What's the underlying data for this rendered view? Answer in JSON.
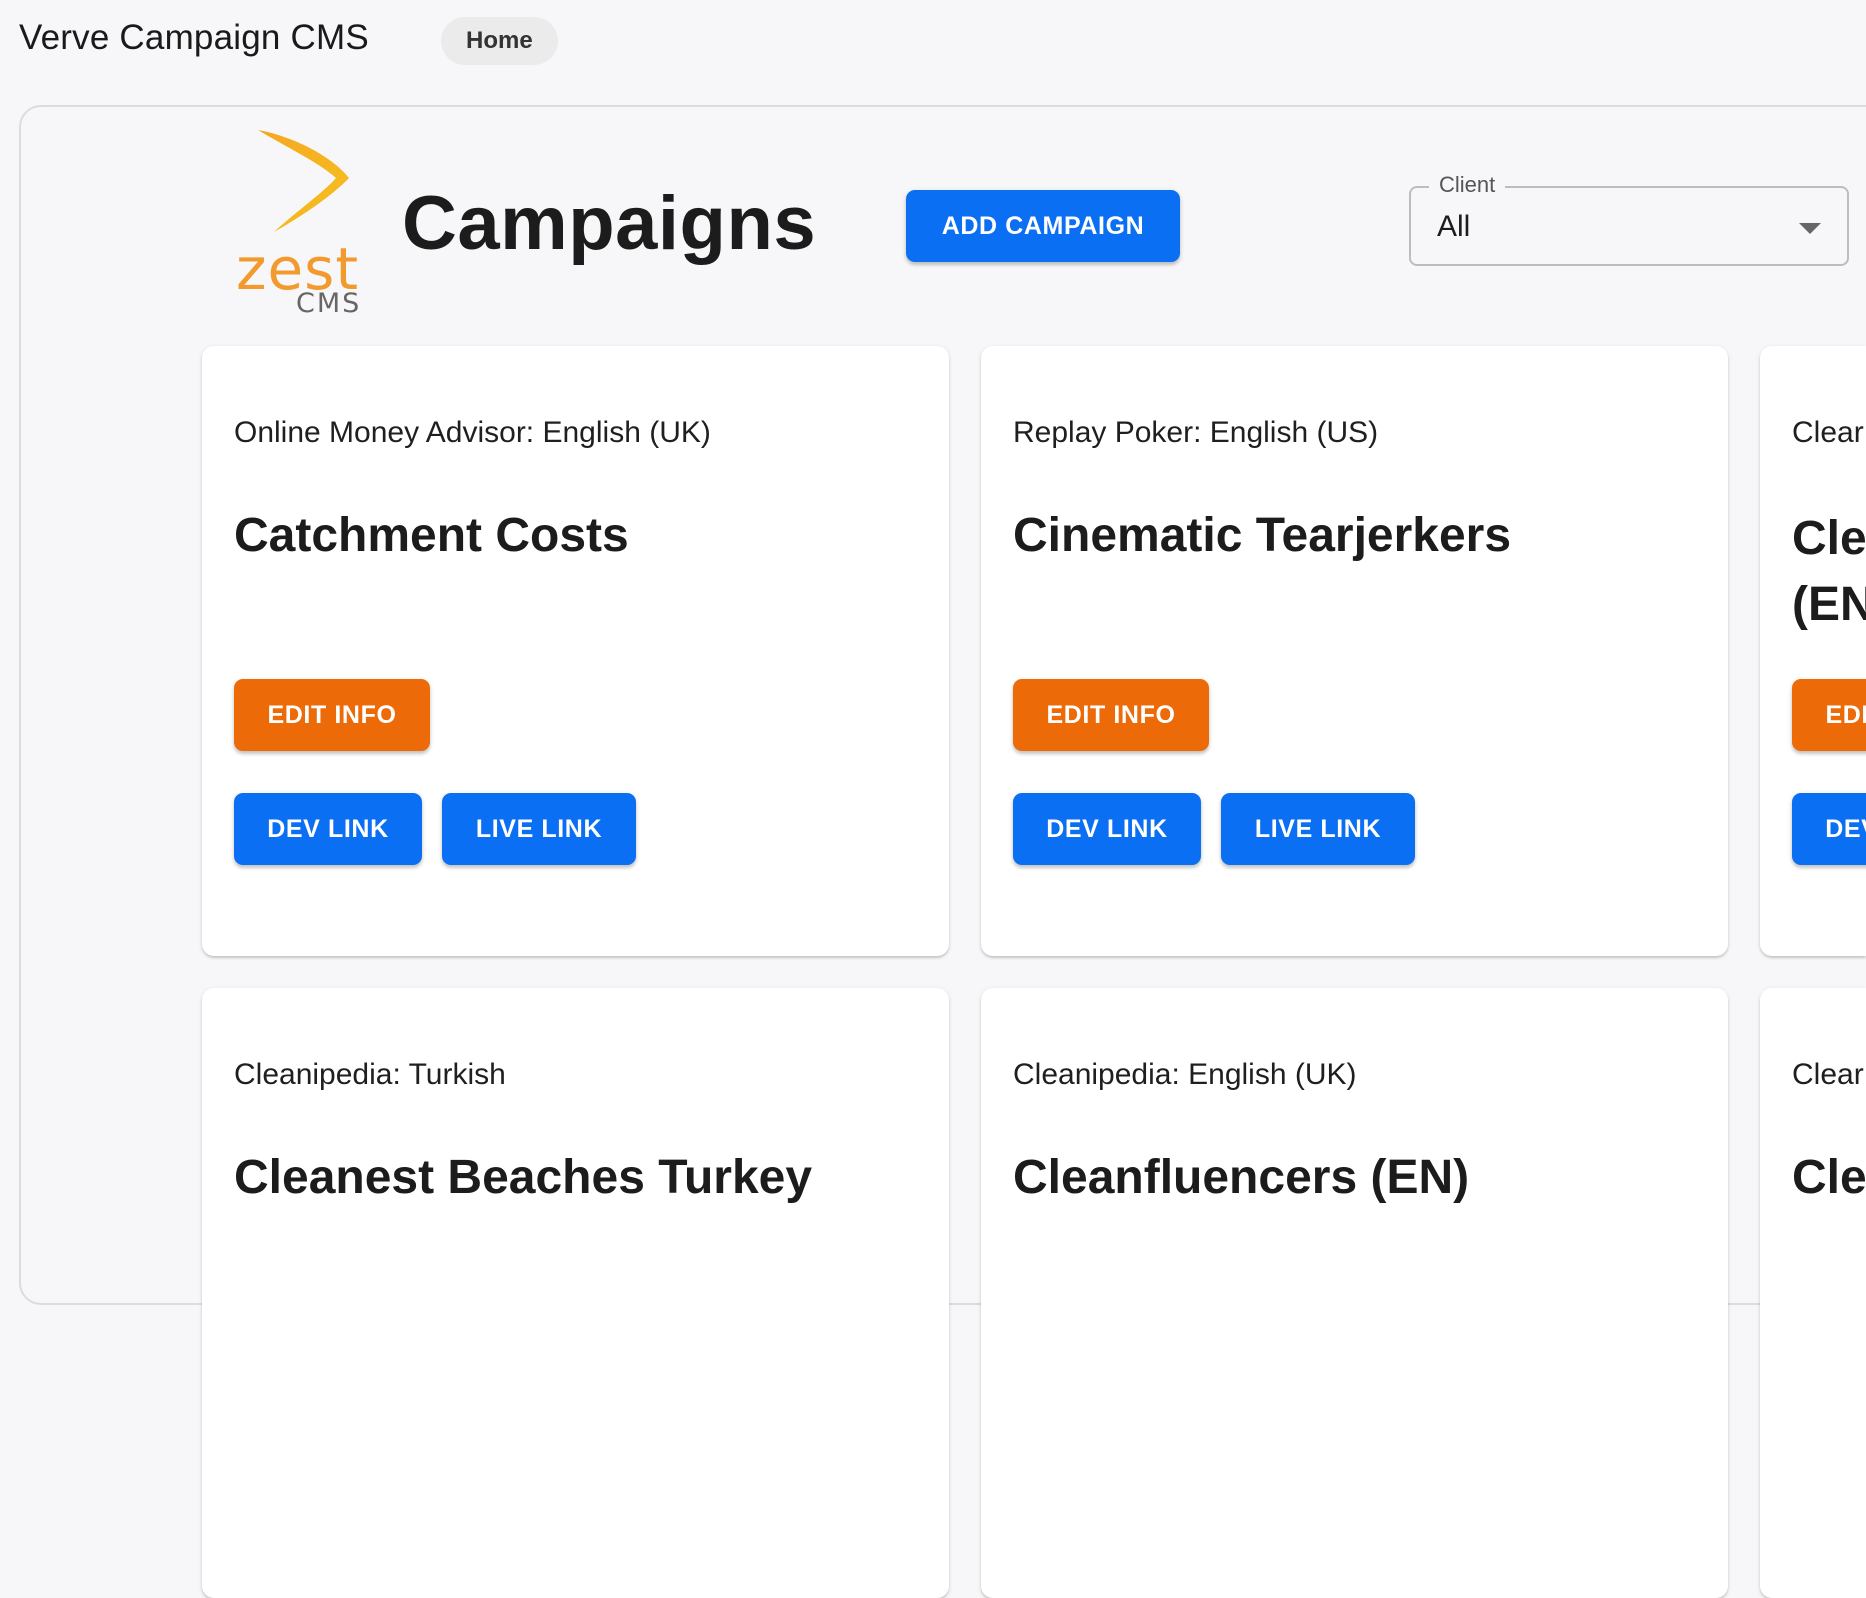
{
  "app": {
    "title": "Verve Campaign CMS",
    "nav_home": "Home"
  },
  "logo": {
    "word": "zest",
    "sub": "CMS"
  },
  "page": {
    "title": "Campaigns",
    "add_button": "ADD CAMPAIGN"
  },
  "filter": {
    "label": "Client",
    "value": "All"
  },
  "buttons": {
    "edit": "EDIT INFO",
    "dev": "DEV LINK",
    "live": "LIVE LINK"
  },
  "cards": [
    {
      "client": "Online Money Advisor: English (UK)",
      "title": "Catchment Costs"
    },
    {
      "client": "Replay Poker: English (US)",
      "title": "Cinematic Tearjerkers"
    },
    {
      "client": "Clear",
      "title": "Cle\n(EN"
    },
    {
      "client": "Cleanipedia: Turkish",
      "title": "Cleanest Beaches Turkey"
    },
    {
      "client": "Cleanipedia: English (UK)",
      "title": "Cleanfluencers (EN)"
    },
    {
      "client": "Clear",
      "title": "Cle"
    }
  ],
  "colors": {
    "primary": "#0a6ff2",
    "accent": "#ec6a08",
    "logo": "#f29a2e"
  }
}
